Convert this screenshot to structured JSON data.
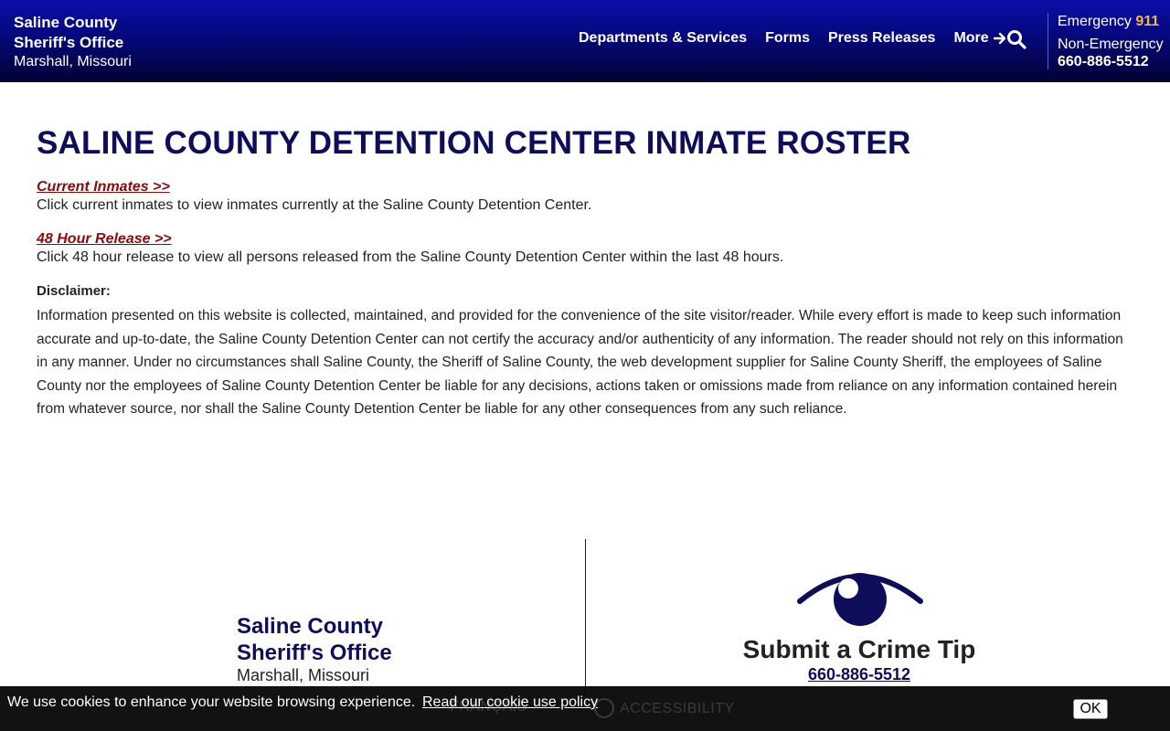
{
  "header": {
    "brand": {
      "line1": "Saline County",
      "line2": "Sheriff's Office",
      "line3": "Marshall, Missouri"
    },
    "nav": [
      "Departments & Services",
      "Forms",
      "Press Releases",
      "More"
    ],
    "contact": {
      "emergency_label": "Emergency",
      "emergency_number": "911",
      "non_emergency_label": "Non-Emergency",
      "non_emergency_number": "660-886-5512"
    }
  },
  "main": {
    "title": "SALINE COUNTY DETENTION CENTER INMATE ROSTER",
    "links": [
      {
        "label": "Current Inmates >>",
        "description": "Click current inmates to view inmates currently at the Saline County Detention Center."
      },
      {
        "label": "48 Hour Release >>",
        "description": "Click 48 hour release to view all persons released from the Saline County Detention Center within the last 48 hours."
      }
    ],
    "disclaimer_label": "Disclaimer:",
    "disclaimer_text": "Information presented on this website is collected, maintained, and provided for the convenience of the site visitor/reader. While every effort is made to keep such information accurate and up-to-date, the Saline County Detention Center can not certify the accuracy and/or authenticity of any information. The reader should not rely on this information in any manner.  Under no circumstances shall Saline County, the Sheriff of Saline County, the web development supplier for Saline County Sheriff, the employees of Saline County nor the employees of Saline County Detention Center be liable for any decisions, actions taken or omissions made from reliance on any information contained herein from whatever source, nor shall the Saline County Detention Center be liable for any other consequences from any such reliance."
  },
  "footer": {
    "brand": {
      "line1": "Saline County",
      "line2": "Sheriff's Office",
      "line3": "Marshall, Missouri"
    },
    "tip": {
      "title": "Submit a Crime Tip",
      "phone": "660-886-5512"
    }
  },
  "cookie": {
    "message": "We use cookies to enhance your website browsing experience.",
    "policy_link": "Read our cookie use policy",
    "ok_label": "OK",
    "behind_left": "FRANÇAIS",
    "behind_right": "ACCESSIBILITY"
  },
  "colors": {
    "header_top": "#0a0ea8",
    "header_bottom": "#020233",
    "title": "#0d0d5c",
    "link": "#8b0a0a",
    "emergency_accent": "#f5b83a"
  }
}
